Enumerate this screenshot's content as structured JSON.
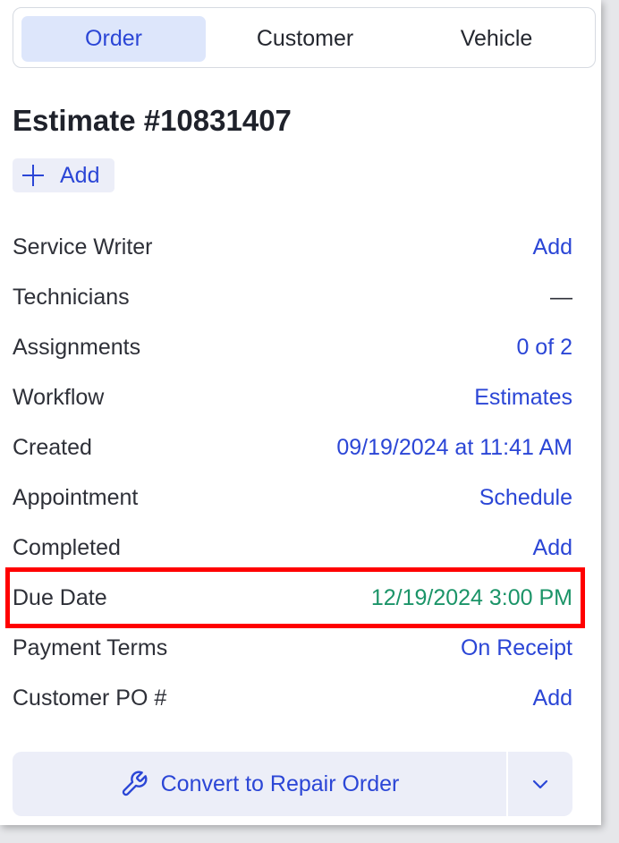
{
  "tabs": [
    {
      "label": "Order",
      "active": true
    },
    {
      "label": "Customer",
      "active": false
    },
    {
      "label": "Vehicle",
      "active": false
    }
  ],
  "estimate": {
    "title": "Estimate #10831407",
    "add_label": "Add"
  },
  "fields": [
    {
      "label": "Service Writer",
      "value": "Add"
    },
    {
      "label": "Technicians",
      "value": "—"
    },
    {
      "label": "Assignments",
      "value": "0 of 2"
    },
    {
      "label": "Workflow",
      "value": "Estimates"
    },
    {
      "label": "Created",
      "value": "09/19/2024 at 11:41 AM"
    },
    {
      "label": "Appointment",
      "value": "Schedule"
    },
    {
      "label": "Completed",
      "value": "Add"
    },
    {
      "label": "Due Date",
      "value": "12/19/2024 3:00 PM"
    },
    {
      "label": "Payment Terms",
      "value": "On Receipt"
    },
    {
      "label": "Customer PO #",
      "value": "Add"
    }
  ],
  "actions": {
    "convert_label": "Convert to Repair Order",
    "convert_icon": "wrench-icon",
    "dropdown_icon": "chevron-down-icon"
  },
  "colors": {
    "accent": "#2b46d6",
    "tab_active_bg": "#dde6fb",
    "due_date": "#1b9468",
    "highlight": "#ff0000"
  }
}
